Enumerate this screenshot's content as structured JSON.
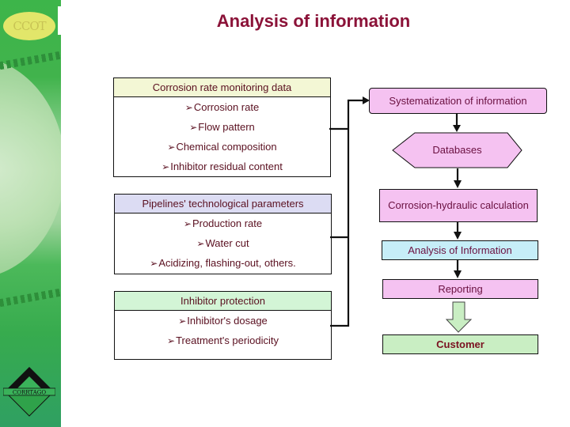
{
  "title": "Analysis of information",
  "sidebar": {
    "logo_top_text": "CCOT",
    "logo_bottom_text": "CORRTAGO"
  },
  "sources": [
    {
      "header": "Corrosion rate monitoring data",
      "header_color": "#f3f7d5",
      "items": [
        "Corrosion rate",
        "Flow pattern",
        "Chemical composition",
        "Inhibitor residual content"
      ]
    },
    {
      "header": "Pipelines' technological parameters",
      "header_color": "#dcdcf3",
      "items": [
        "Production rate",
        "Water cut",
        "Acidizing, flashing-out, others."
      ]
    },
    {
      "header": "Inhibitor protection",
      "header_color": "#d3f5d6",
      "items": [
        "Inhibitor's dosage",
        "Treatment's periodicity"
      ]
    }
  ],
  "bullet_glyph": "➢",
  "flow": {
    "systematization": "Systematization of  information",
    "databases": "Databases",
    "calculation": "Corrosion-hydraulic calculation",
    "analysis": "Analysis of Information",
    "reporting": "Reporting",
    "customer": "Customer"
  },
  "colors": {
    "title": "#8b1238",
    "pink": "#f5c2f1",
    "cyan": "#c6eef8",
    "green": "#c9eec3",
    "text": "#5a1020"
  }
}
